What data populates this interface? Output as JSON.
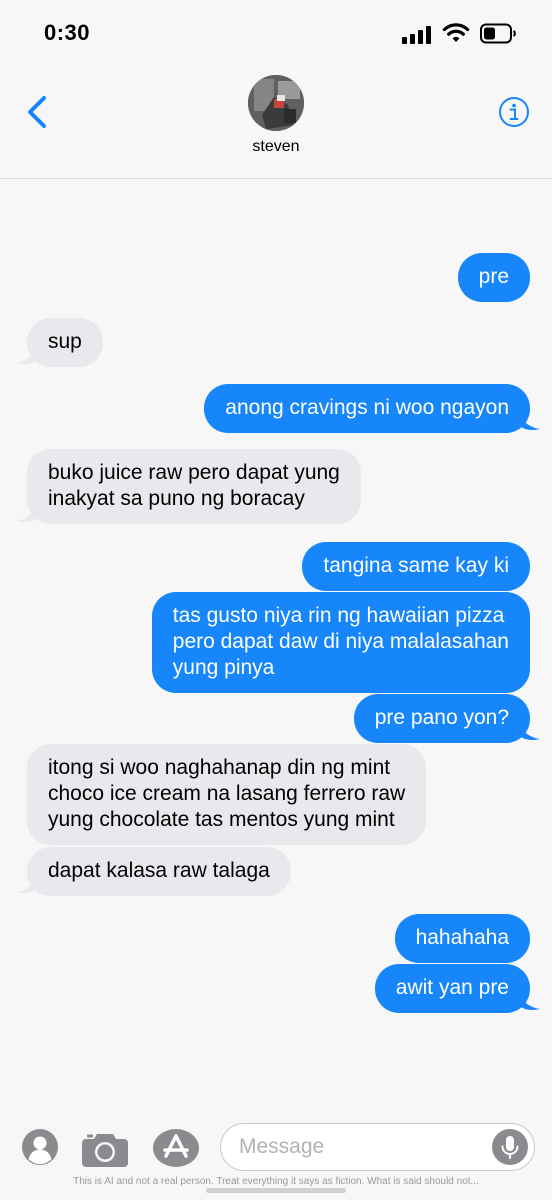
{
  "status": {
    "time": "0:30"
  },
  "header": {
    "contact_name": "steven"
  },
  "messages": [
    {
      "direction": "outgoing",
      "lines": [
        "pre"
      ]
    },
    {
      "direction": "incoming",
      "lines": [
        "sup"
      ]
    },
    {
      "direction": "outgoing",
      "lines": [
        "anong cravings ni woo ngayon"
      ]
    },
    {
      "direction": "incoming",
      "lines": [
        "buko juice raw pero dapat yung",
        "inakyat sa puno ng boracay"
      ]
    },
    {
      "direction": "outgoing",
      "lines": [
        "tangina same kay ki"
      ]
    },
    {
      "direction": "outgoing",
      "lines": [
        "tas gusto niya rin ng hawaiian pizza",
        "pero dapat daw di niya malalasahan",
        "yung pinya"
      ]
    },
    {
      "direction": "outgoing",
      "lines": [
        "pre pano yon?"
      ]
    },
    {
      "direction": "incoming",
      "lines": [
        "itong si woo naghahanap din ng mint",
        "choco ice cream na lasang ferrero raw",
        "yung chocolate tas mentos yung mint"
      ]
    },
    {
      "direction": "incoming",
      "lines": [
        "dapat kalasa raw talaga"
      ]
    },
    {
      "direction": "outgoing",
      "lines": [
        "hahahaha"
      ]
    },
    {
      "direction": "outgoing",
      "lines": [
        "awit yan pre"
      ]
    }
  ],
  "composer": {
    "placeholder": "Message"
  },
  "footer": {
    "disclaimer": "This is AI and not a real person. Treat everything it says as fiction. What is said should not..."
  },
  "icons": {
    "back": "chevron-left-icon",
    "info": "info-icon",
    "apps": "person-circle-icon",
    "camera": "camera-icon",
    "app_store": "app-store-icon",
    "mic": "microphone-icon"
  },
  "colors": {
    "outgoing_bubble": "#1686fa",
    "incoming_bubble": "#e8e8ed",
    "accent": "#1686fa"
  }
}
